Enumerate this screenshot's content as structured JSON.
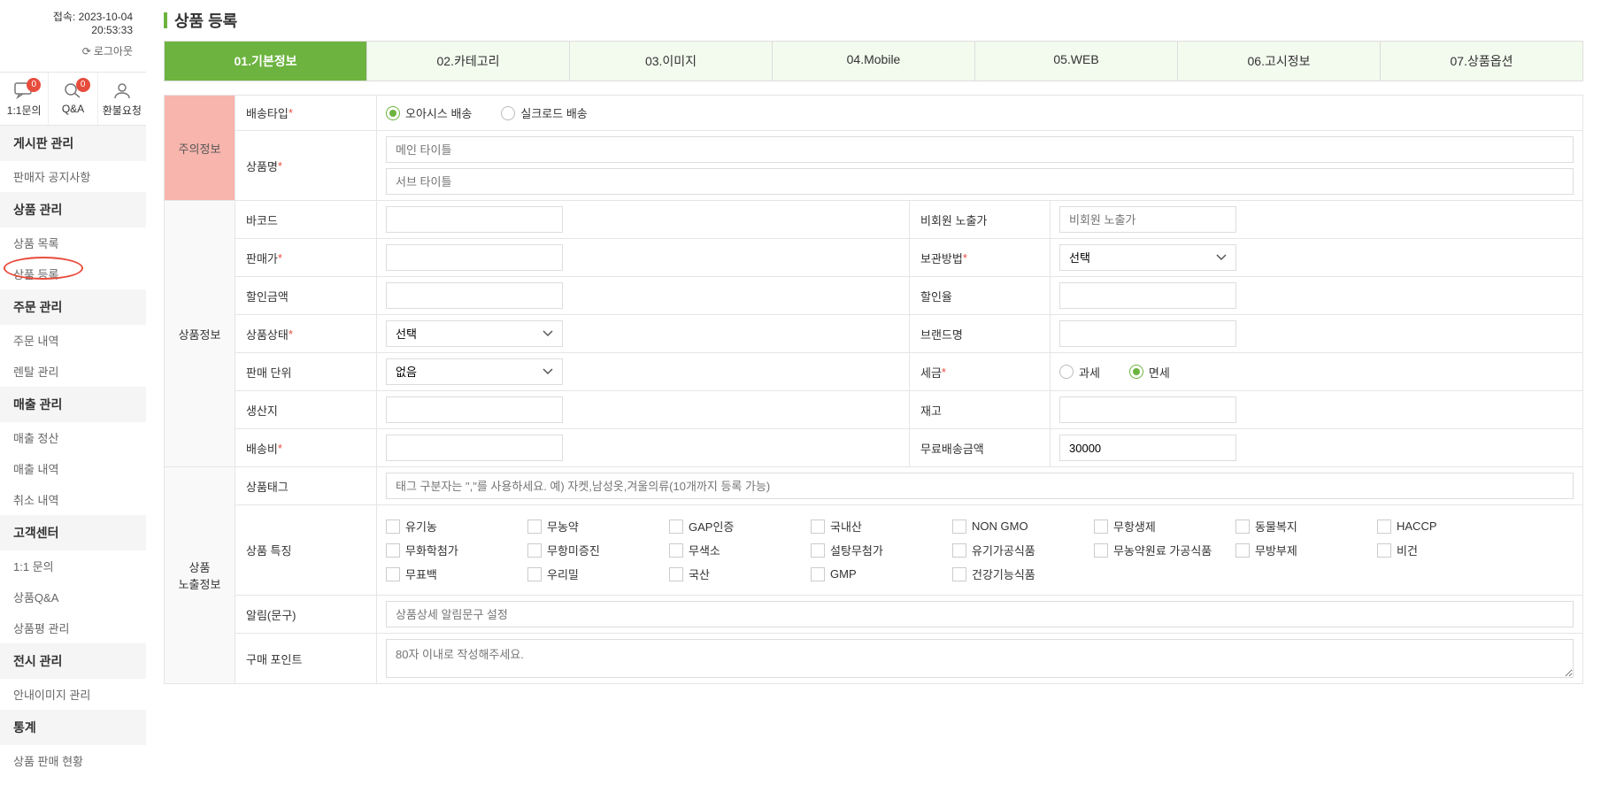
{
  "sidebar": {
    "access_text": "접속: 2023-10-04 20:53:33",
    "logout_label": "로그아웃",
    "icons": [
      {
        "label": "1:1문의",
        "badge": "0"
      },
      {
        "label": "Q&A",
        "badge": "0"
      },
      {
        "label": "환불요청",
        "badge": null
      }
    ],
    "menu": [
      {
        "header": "게시판 관리",
        "items": [
          "판매자 공지사항"
        ]
      },
      {
        "header": "상품 관리",
        "items": [
          "상품 목록",
          "상품 등록"
        ]
      },
      {
        "header": "주문 관리",
        "items": [
          "주문 내역",
          "렌탈 관리"
        ]
      },
      {
        "header": "매출 관리",
        "items": [
          "매출 정산",
          "매출 내역",
          "취소 내역"
        ]
      },
      {
        "header": "고객센터",
        "items": [
          "1:1 문의",
          "상품Q&A",
          "상품평 관리"
        ]
      },
      {
        "header": "전시 관리",
        "items": [
          "안내이미지 관리"
        ]
      },
      {
        "header": "통계",
        "items": [
          "상품 판매 현황"
        ]
      }
    ]
  },
  "page_title": "상품 등록",
  "tabs": [
    "01.기본정보",
    "02.카테고리",
    "03.이미지",
    "04.Mobile",
    "05.WEB",
    "06.고시정보",
    "07.상품옵션"
  ],
  "sections": {
    "warning": "주의정보",
    "product_info": "상품정보",
    "expose_info": "상품\n노출정보"
  },
  "labels": {
    "ship_type": "배송타입",
    "product_name": "상품명",
    "barcode": "바코드",
    "nonmember_price": "비회원 노출가",
    "sale_price": "판매가",
    "storage": "보관방법",
    "discount_amount": "할인금액",
    "discount_rate": "할인율",
    "product_status": "상품상태",
    "brand_name": "브랜드명",
    "sale_unit": "판매 단위",
    "tax": "세금",
    "origin": "생산지",
    "stock": "재고",
    "ship_fee": "배송비",
    "free_ship_amount": "무료배송금액",
    "product_tag": "상품태그",
    "product_feature": "상품 특징",
    "notice_text": "알림(문구)",
    "purchase_point": "구매 포인트"
  },
  "radios": {
    "ship_type": {
      "options": [
        "오아시스 배송",
        "실크로드 배송"
      ],
      "selected": 0
    },
    "tax": {
      "options": [
        "과세",
        "면세"
      ],
      "selected": 1
    }
  },
  "placeholders": {
    "main_title": "메인 타이틀",
    "sub_title": "서브 타이틀",
    "nonmember_price": "비회원 노출가",
    "tag": "태그 구분자는 \",\"를 사용하세요. 예) 자켓,남성옷,겨울의류(10개까지 등록 가능)",
    "notice": "상품상세 알림문구 설정",
    "point": "80자 이내로 작성해주세요."
  },
  "selects": {
    "storage": "선택",
    "product_status": "선택",
    "sale_unit": "없음"
  },
  "values": {
    "free_ship_amount": "30000"
  },
  "features": [
    "유기농",
    "무농약",
    "GAP인증",
    "국내산",
    "NON GMO",
    "무항생제",
    "동물복지",
    "HACCP",
    "무화학첨가",
    "무항미증진",
    "무색소",
    "설탕무첨가",
    "유기가공식품",
    "무농약원료 가공식품",
    "무방부제",
    "비건",
    "무표백",
    "우리밀",
    "국산",
    "GMP",
    "건강기능식품"
  ]
}
